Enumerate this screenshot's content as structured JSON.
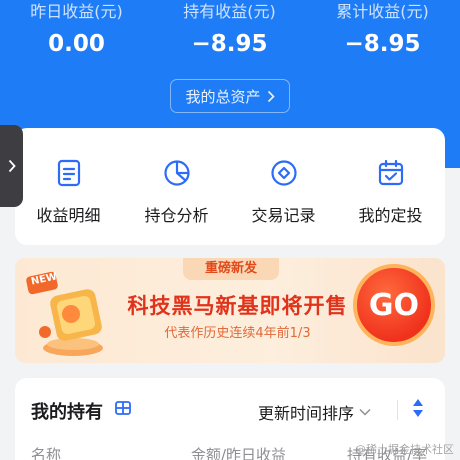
{
  "summary": {
    "yesterday_label": "昨日收益(元)",
    "yesterday_value": "0.00",
    "holding_label": "持有收益(元)",
    "holding_value": "−8.95",
    "total_label": "累计收益(元)",
    "total_value": "−8.95",
    "assets_button": "我的总资产"
  },
  "menu": {
    "items": [
      {
        "label": "收益明细",
        "icon": "document-list-icon"
      },
      {
        "label": "持仓分析",
        "icon": "pie-chart-icon"
      },
      {
        "label": "交易记录",
        "icon": "diamond-record-icon"
      },
      {
        "label": "我的定投",
        "icon": "calendar-check-icon"
      }
    ]
  },
  "banner": {
    "tag": "重磅新发",
    "badge": "NEW",
    "title": "科技黑马新基即将开售",
    "subtitle": "代表作历史连续4年前1/3",
    "go_label": "GO"
  },
  "holdings": {
    "title": "我的持有",
    "sort_label": "更新时间排序",
    "columns": [
      "名称",
      "金额/昨日收益",
      "持有收益/率"
    ]
  },
  "watermark": "@稀土掘金技术社区",
  "colors": {
    "header_bg": "#1f7cf7",
    "accent_blue": "#2d6cf6",
    "banner_red": "#e0331c"
  }
}
